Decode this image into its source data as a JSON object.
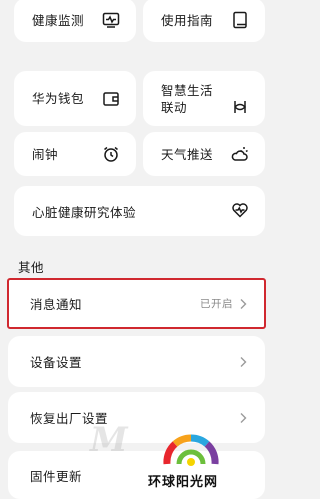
{
  "grid": {
    "health_monitor": "健康监测",
    "user_guide": "使用指南",
    "huawei_wallet": "华为钱包",
    "smart_life_line1": "智慧生活",
    "smart_life_line2": "联动",
    "alarm": "闹钟",
    "weather_push": "天气推送"
  },
  "heart_study": "心脏健康研究体验",
  "section_other": "其他",
  "list": {
    "notifications": "消息通知",
    "notifications_status": "已开启",
    "device_settings": "设备设置",
    "factory_reset": "恢复出厂设置",
    "firmware_update": "固件更新"
  },
  "watermark": {
    "letter": "M",
    "brand": "环球阳光网"
  },
  "colors": {
    "highlight": "#d0282f",
    "background": "#f2f2f2",
    "card": "#ffffff"
  },
  "icons": {
    "health_monitor": "activity-monitor-icon",
    "user_guide": "book-icon",
    "huawei_wallet": "wallet-icon",
    "smart_life": "link-icon",
    "alarm": "alarm-clock-icon",
    "weather_push": "weather-icon",
    "heart_study": "heart-pulse-icon"
  }
}
